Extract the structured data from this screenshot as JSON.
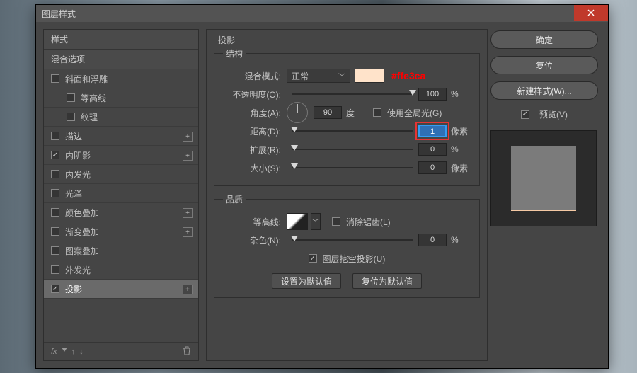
{
  "window": {
    "title": "图层样式"
  },
  "sidebar": {
    "styles_label": "样式",
    "blend_label": "混合选项",
    "items": [
      {
        "label": "斜面和浮雕",
        "checked": false,
        "add": false,
        "sub": false
      },
      {
        "label": "等高线",
        "checked": false,
        "add": false,
        "sub": true
      },
      {
        "label": "纹理",
        "checked": false,
        "add": false,
        "sub": true
      },
      {
        "label": "描边",
        "checked": false,
        "add": true,
        "sub": false
      },
      {
        "label": "内阴影",
        "checked": true,
        "add": true,
        "sub": false
      },
      {
        "label": "内发光",
        "checked": false,
        "add": false,
        "sub": false
      },
      {
        "label": "光泽",
        "checked": false,
        "add": false,
        "sub": false
      },
      {
        "label": "颜色叠加",
        "checked": false,
        "add": true,
        "sub": false
      },
      {
        "label": "渐变叠加",
        "checked": false,
        "add": true,
        "sub": false
      },
      {
        "label": "图案叠加",
        "checked": false,
        "add": false,
        "sub": false
      },
      {
        "label": "外发光",
        "checked": false,
        "add": false,
        "sub": false
      },
      {
        "label": "投影",
        "checked": true,
        "add": true,
        "sub": false,
        "active": true
      }
    ],
    "footer_fx": "fx"
  },
  "panel": {
    "title": "投影",
    "struct_legend": "结构",
    "blend_mode_label": "混合模式:",
    "blend_mode_value": "正常",
    "swatch_color": "#ffe3ca",
    "annotation": "#ffe3ca",
    "opacity_label": "不透明度(O):",
    "opacity_value": "100",
    "opacity_unit": "%",
    "angle_label": "角度(A):",
    "angle_value": "90",
    "angle_unit": "度",
    "global_light_label": "使用全局光(G)",
    "distance_label": "距离(D):",
    "distance_value": "1",
    "distance_unit": "像素",
    "spread_label": "扩展(R):",
    "spread_value": "0",
    "spread_unit": "%",
    "size_label": "大小(S):",
    "size_value": "0",
    "size_unit": "像素",
    "quality_legend": "品质",
    "contour_label": "等高线:",
    "antialias_label": "消除锯齿(L)",
    "noise_label": "杂色(N):",
    "noise_value": "0",
    "noise_unit": "%",
    "knockout_label": "图层挖空投影(U)",
    "set_default": "设置为默认值",
    "reset_default": "复位为默认值"
  },
  "right": {
    "ok": "确定",
    "cancel": "复位",
    "new_style": "新建样式(W)...",
    "preview": "预览(V)"
  }
}
